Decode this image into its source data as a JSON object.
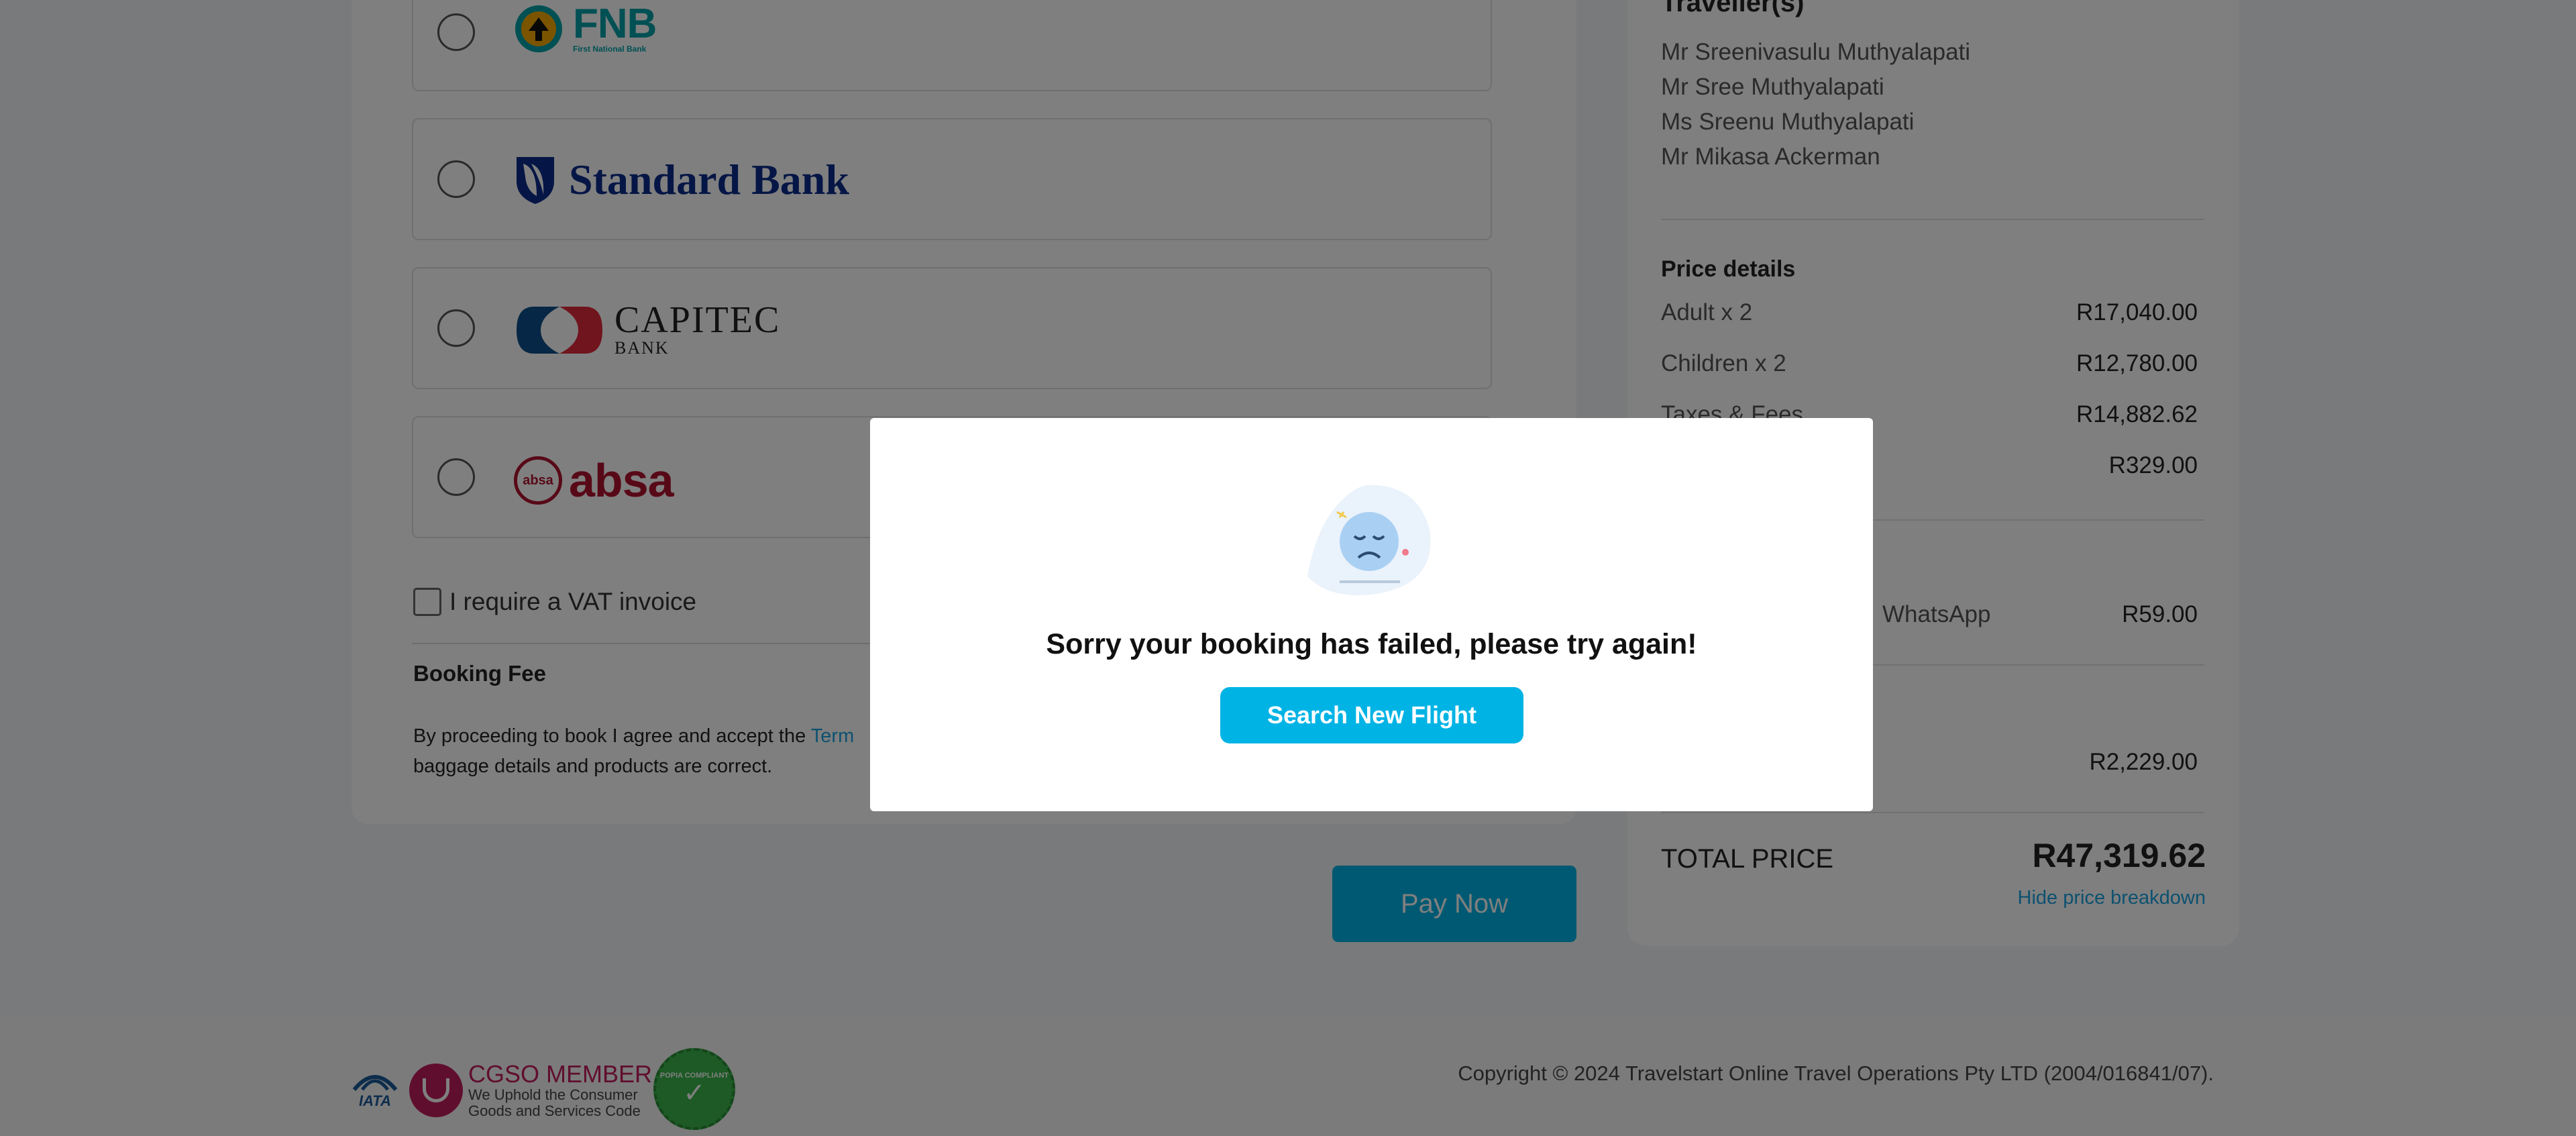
{
  "banks": [
    {
      "name": "FNB",
      "subtitle": "First National Bank"
    },
    {
      "name": "Standard Bank"
    },
    {
      "name": "CAPITEC",
      "subtitle": "BANK"
    },
    {
      "name": "absa",
      "badge": "absa"
    }
  ],
  "vat_label": "I require a VAT invoice",
  "booking_fee_heading": "Booking Fee",
  "terms": {
    "prefix": "By proceeding to book I agree and accept the ",
    "link": "Term",
    "line2": "baggage details and products are correct."
  },
  "pay_now_label": "Pay Now",
  "summary": {
    "travellers_heading": "Traveller(s)",
    "travellers": [
      "Mr Sreenivasulu Muthyalapati",
      "Mr Sree Muthyalapati",
      "Ms Sreenu Muthyalapati",
      "Mr Mikasa Ackerman"
    ],
    "price_heading": "Price details",
    "prices": [
      {
        "label": "Adult x 2",
        "amount": "R17,040.00"
      },
      {
        "label": "Children x 2",
        "amount": "R12,780.00"
      },
      {
        "label": "Taxes & Fees",
        "amount": "R14,882.62"
      },
      {
        "label": "",
        "amount": "R329.00"
      }
    ],
    "whatsapp": {
      "label": "WhatsApp",
      "amount": "R59.00"
    },
    "extra_amount": "R2,229.00",
    "total_label": "TOTAL PRICE",
    "total_amount": "R47,319.62",
    "hide_breakdown": "Hide price breakdown"
  },
  "footer": {
    "iata": "IATA",
    "cgso_title": "CGSO MEMBER",
    "cgso_sub1": "We Uphold the Consumer",
    "cgso_sub2": "Goods and Services Code",
    "popia": "POPIA COMPLIANT",
    "copyright": "Copyright © 2024 Travelstart Online Travel Operations Pty LTD (2004/016841/07)."
  },
  "modal": {
    "message": "Sorry your booking has failed, please try again!",
    "button": "Search New Flight"
  },
  "colors": {
    "accent": "#00b3e5",
    "link": "#1aa3e0",
    "fnb": "#00a0a8",
    "standard_bank": "#0a2c8c",
    "capitec_red": "#e0283a",
    "capitec_blue": "#0d4f8b",
    "absa": "#b0122e"
  }
}
